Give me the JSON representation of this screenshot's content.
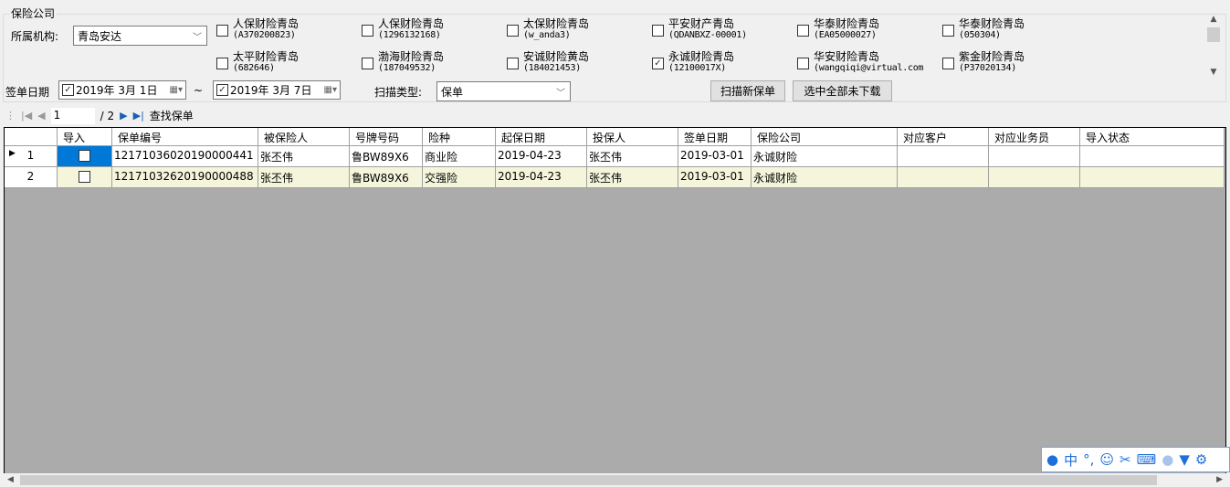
{
  "group_title": "保险公司",
  "org_label": "所属机构:",
  "org_value": "青岛安达",
  "companies": [
    {
      "name": "人保财险青岛",
      "code": "(A370200823)",
      "checked": false
    },
    {
      "name": "人保财险青岛",
      "code": "(1296132168)",
      "checked": false
    },
    {
      "name": "太保财险青岛",
      "code": "(w_anda3)",
      "checked": false
    },
    {
      "name": "平安财产青岛",
      "code": "(QDANBXZ-00001)",
      "checked": false
    },
    {
      "name": "华泰财险青岛",
      "code": "(EA05000027)",
      "checked": false
    },
    {
      "name": "华泰财险青岛",
      "code": "(050304)",
      "checked": false
    },
    {
      "name": "太平财险青岛",
      "code": "(682646)",
      "checked": false
    },
    {
      "name": "渤海财险青岛",
      "code": "(187049532)",
      "checked": false
    },
    {
      "name": "安诚财险黄岛",
      "code": "(184021453)",
      "checked": false
    },
    {
      "name": "永诚财险青岛",
      "code": "(12100017X)",
      "checked": true
    },
    {
      "name": "华安财险青岛",
      "code": "(wangqiqi@virtual.com",
      "checked": false
    },
    {
      "name": "紫金财险青岛",
      "code": "(P37020134)",
      "checked": false
    }
  ],
  "date_label": "签单日期",
  "date_from": "2019年 3月 1日",
  "date_sep": "~",
  "date_to": "2019年 3月 7日",
  "scan_type_label": "扫描类型:",
  "scan_type_value": "保单",
  "scan_button": "扫描新保单",
  "select_all_button": "选中全部未下载",
  "pager": {
    "current": "1",
    "total": "/ 2",
    "find": "查找保单"
  },
  "columns": [
    "",
    "导入",
    "保单编号",
    "被保险人",
    "号牌号码",
    "险种",
    "起保日期",
    "投保人",
    "签单日期",
    "保险公司",
    "对应客户",
    "对应业务员",
    "导入状态"
  ],
  "rows": [
    [
      "1",
      "",
      "12171036020190000441",
      "张丕伟",
      "鲁BW89X6",
      "商业险",
      "2019-04-23",
      "张丕伟",
      "2019-03-01",
      "永诚财险",
      "",
      "",
      ""
    ],
    [
      "2",
      "",
      "12171032620190000488",
      "张丕伟",
      "鲁BW89X6",
      "交强险",
      "2019-04-23",
      "张丕伟",
      "2019-03-01",
      "永诚财险",
      "",
      "",
      ""
    ]
  ],
  "ime": {
    "lang": "中",
    "punct": "°,"
  }
}
